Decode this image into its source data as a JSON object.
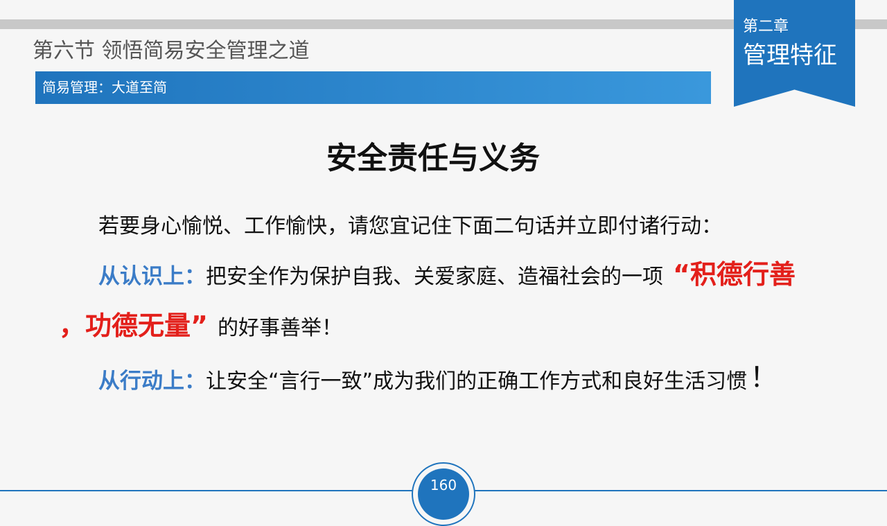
{
  "header": {
    "section_title": "第六节  领悟简易安全管理之道",
    "subtitle": "简易管理：大道至简"
  },
  "chapter_badge": {
    "label": "第二章",
    "name": "管理特征"
  },
  "content": {
    "heading": "安全责任与义务",
    "intro": "若要身心愉悦、工作愉快，请您宜记住下面二句话并立即付诸行动：",
    "point1": {
      "lead": "从认识上：",
      "text_before": "把安全作为保护自我、关爱家庭、造福社会的一项",
      "emphasis_part1": "“积德行善",
      "emphasis_part2": "，功德无量”",
      "text_after": "的好事善举！"
    },
    "point2": {
      "lead": "从行动上：",
      "text": "让安全“言行一致”成为我们的正确工作方式和良好生活习惯",
      "end_mark": "！"
    }
  },
  "footer": {
    "page_number": "160"
  },
  "colors": {
    "primary_blue": "#1f74bd",
    "lead_blue": "#3b7cc7",
    "emphasis_red": "#e3201b",
    "background": "#f6f6f6"
  }
}
